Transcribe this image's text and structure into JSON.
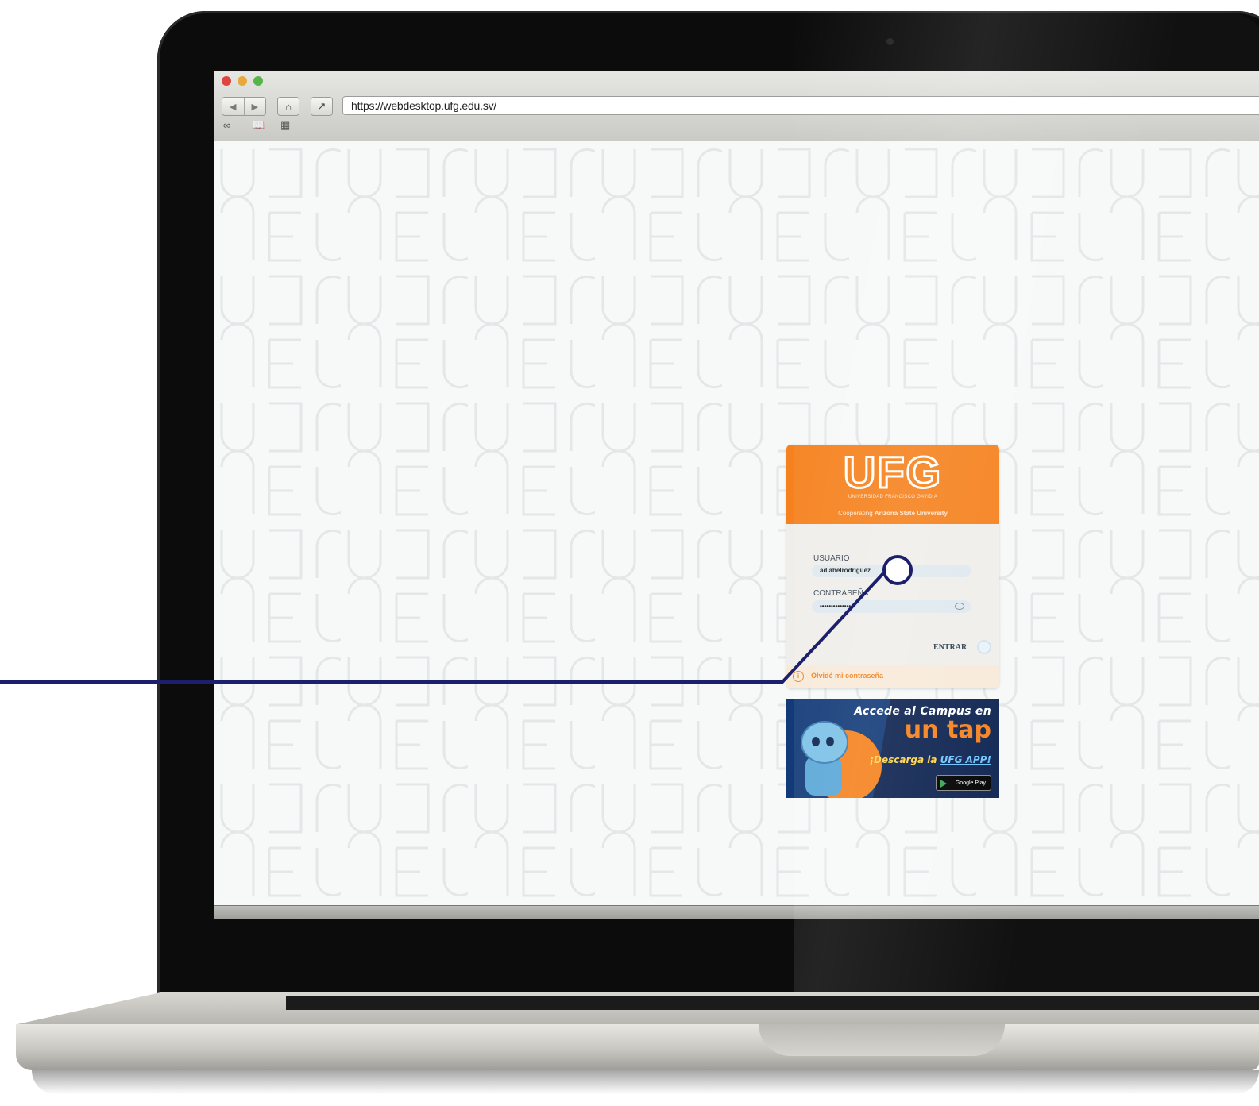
{
  "browser": {
    "url": "https://webdesktop.ufg.edu.sv/",
    "nav_back_icon": "back-arrow-icon",
    "nav_forward_icon": "forward-arrow-icon",
    "home_icon": "home-icon",
    "share_icon": "share-icon",
    "bookmark_icons": [
      "reading-glasses-icon",
      "book-icon",
      "grid-icon"
    ]
  },
  "login": {
    "logo": "UFG",
    "university_name": "UNIVERSIDAD FRANCISCO GAVIDIA",
    "partner_prefix": "Cooperating",
    "partner_name": "Arizona State University",
    "username_label": "USUARIO",
    "username_value": "ad abelrodriguez",
    "password_label": "CONTRASEÑA",
    "password_value": "•••••••••••••••",
    "enter_label": "ENTRAR",
    "forgot_label": "Olvidé mi contraseña"
  },
  "promo": {
    "line1": "Accede al Campus en",
    "line2": "un tap",
    "line3_prefix": "¡Descarga la",
    "line3_app": "UFG APP!",
    "store_label": "Google Play"
  },
  "colors": {
    "brand_orange": "#f5821f",
    "promo_navy": "#0d2350",
    "callout_line": "#1c1f6b"
  }
}
